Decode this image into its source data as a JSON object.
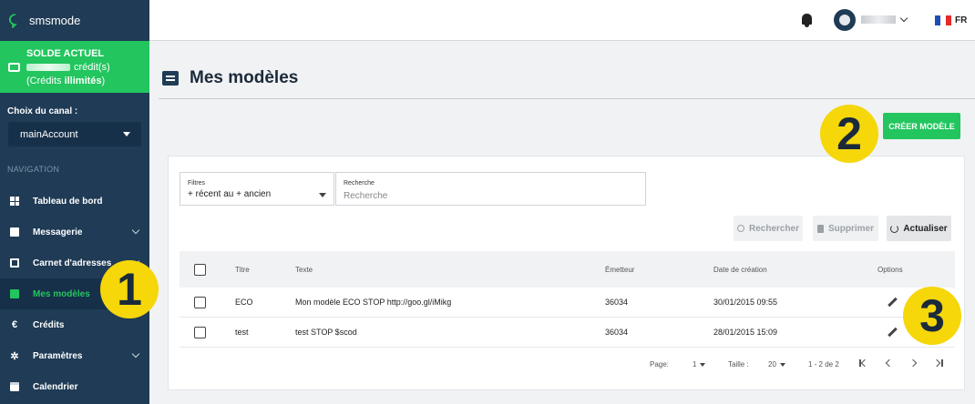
{
  "brand": {
    "name": "smsmode"
  },
  "balance": {
    "title": "SOLDE ACTUEL",
    "credits_suffix": "crédit(s)",
    "credits_note_prefix": "(Crédits ",
    "credits_note_bold": "illimités",
    "credits_note_suffix": ")"
  },
  "channel": {
    "label": "Choix du canal :",
    "value": "mainAccount"
  },
  "navigation": {
    "label": "NAVIGATION",
    "items": [
      {
        "label": "Tableau de bord",
        "icon": "dashboard-icon"
      },
      {
        "label": "Messagerie",
        "icon": "chat-icon"
      },
      {
        "label": "Carnet d'adresses",
        "icon": "address-book-icon"
      },
      {
        "label": "Mes modèles",
        "icon": "template-icon"
      },
      {
        "label": "Crédits",
        "icon": "euro-icon"
      },
      {
        "label": "Paramètres",
        "icon": "gear-icon"
      },
      {
        "label": "Calendrier",
        "icon": "calendar-icon"
      }
    ],
    "active": "Mes modèles"
  },
  "topbar": {
    "lang": "FR"
  },
  "page": {
    "title": "Mes modèles",
    "create_button": "CRÉER MODÈLE"
  },
  "filters": {
    "label": "Filtres",
    "value": "+ récent au + ancien"
  },
  "search": {
    "label": "Recherche",
    "placeholder": "Recherche"
  },
  "actions": {
    "search": "Rechercher",
    "delete": "Supprimer",
    "refresh": "Actualiser"
  },
  "table": {
    "columns": [
      "Titre",
      "Texte",
      "Émetteur",
      "Date de création",
      "Options"
    ],
    "rows": [
      {
        "title": "ECO",
        "text": "Mon modèle ECO STOP http://goo.gl/iMikg",
        "sender": "36034",
        "date": "30/01/2015 09:55"
      },
      {
        "title": "test",
        "text": "test STOP $scod",
        "sender": "36034",
        "date": "28/01/2015 15:09"
      }
    ]
  },
  "pagination": {
    "page_label": "Page:",
    "page_value": "1",
    "size_label": "Taille :",
    "size_value": "20",
    "range": "1 - 2 de 2"
  },
  "callouts": [
    "1",
    "2",
    "3"
  ],
  "colors": {
    "sidebar": "#1f3b55",
    "accent": "#22c55e",
    "callout": "#f5d70a"
  }
}
